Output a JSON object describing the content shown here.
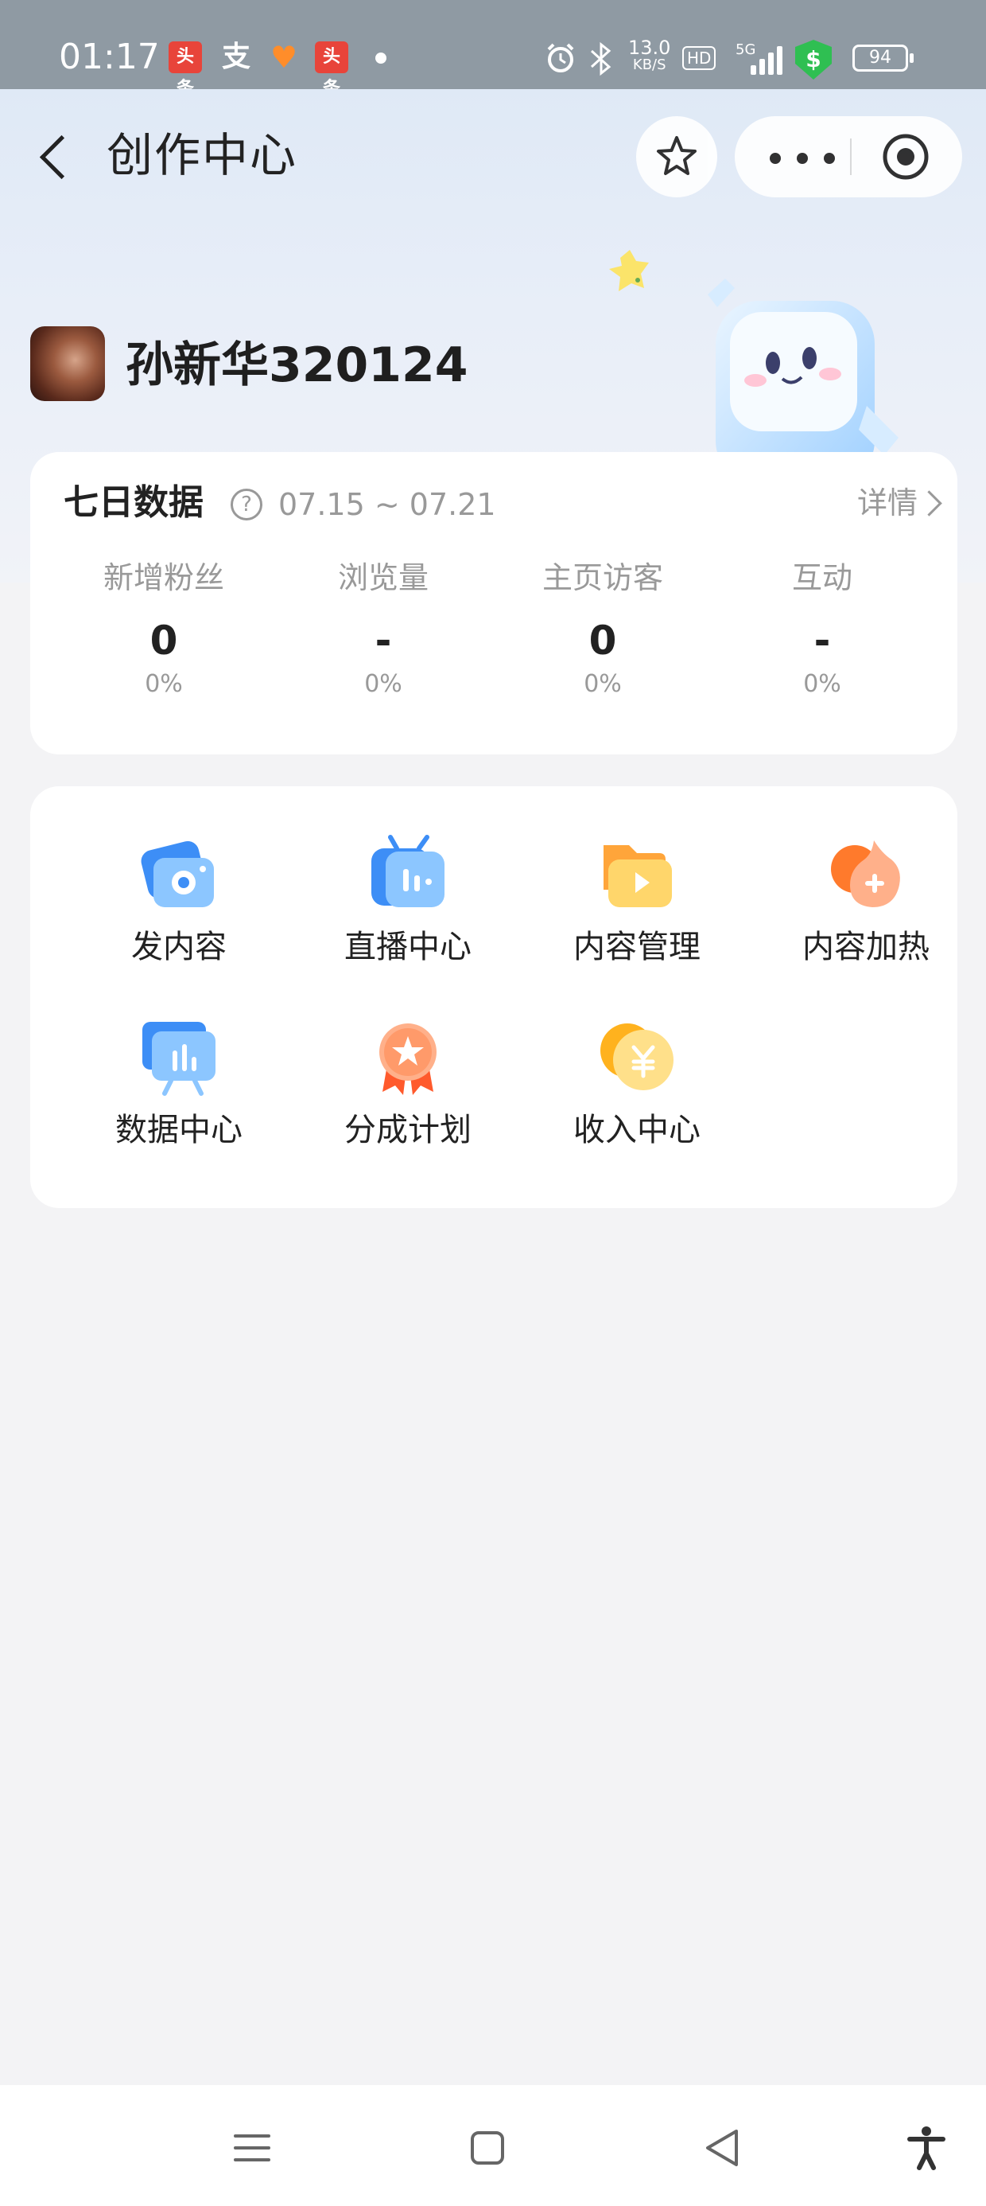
{
  "status_bar": {
    "time": "01:17",
    "apps": [
      "头条",
      "支",
      "",
      "头条"
    ],
    "network_speed": "13.0",
    "network_speed_unit": "KB/S",
    "hd": "HD",
    "signal_type": "5G",
    "battery": "94",
    "shield_symbol": "$"
  },
  "header": {
    "title": "创作中心"
  },
  "profile": {
    "username": "孙新华320124"
  },
  "weekly_data": {
    "title": "七日数据",
    "help": "?",
    "date_range": "07.15 ~ 07.21",
    "detail_label": "详情",
    "metrics": [
      {
        "label": "新增粉丝",
        "value": "0",
        "change": "0%"
      },
      {
        "label": "浏览量",
        "value": "-",
        "change": "0%"
      },
      {
        "label": "主页访客",
        "value": "0",
        "change": "0%"
      },
      {
        "label": "互动",
        "value": "-",
        "change": "0%"
      }
    ]
  },
  "tools": [
    {
      "label": "发内容",
      "icon": "camera-icon"
    },
    {
      "label": "直播中心",
      "icon": "tv-icon"
    },
    {
      "label": "内容管理",
      "icon": "folder-play-icon"
    },
    {
      "label": "内容加热",
      "icon": "flame-plus-icon"
    },
    {
      "label": "数据中心",
      "icon": "bar-chart-icon"
    },
    {
      "label": "分成计划",
      "icon": "medal-icon"
    },
    {
      "label": "收入中心",
      "icon": "coin-yen-icon"
    }
  ],
  "colors": {
    "status_bar_bg": "#8f9aa3",
    "hero_gradient_top": "#dfe9f6",
    "page_bg": "#f3f3f5",
    "blue_accent": "#3d8ef6",
    "orange_accent": "#ff8a3d",
    "gold_accent": "#ffc23d"
  }
}
